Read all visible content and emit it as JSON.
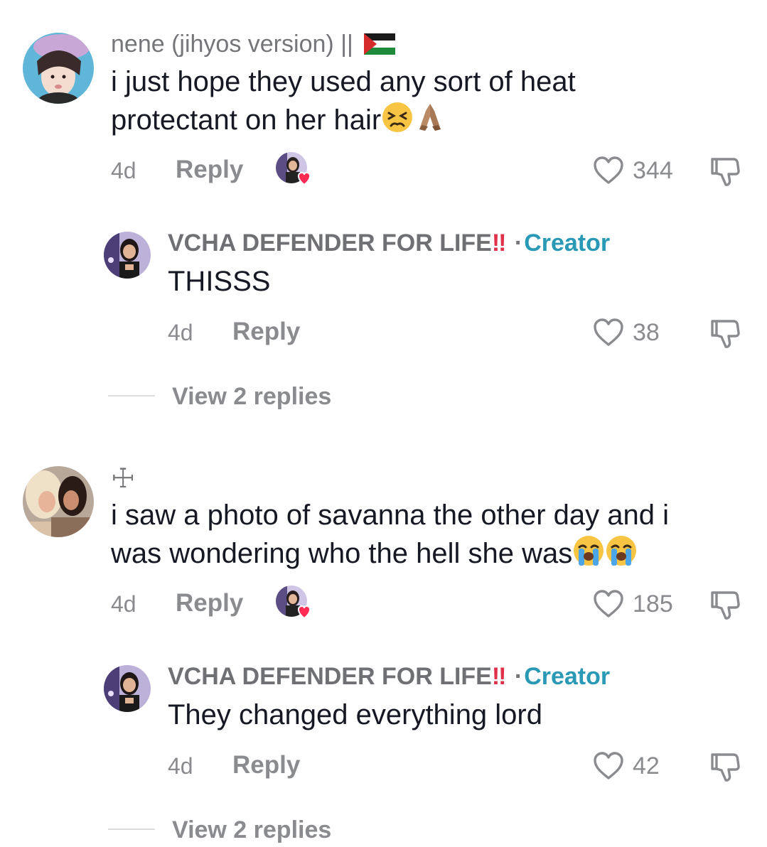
{
  "comments": [
    {
      "username": "nene (jihyos version) ||",
      "text_line1": "i just hope they used any sort of heat",
      "text_line2": "protectant on her hair",
      "time": "4d",
      "reply_label": "Reply",
      "likes": "344",
      "reply": {
        "username": "VCHA DEFENDER FOR LIFE",
        "bangs": "‼",
        "separator": "·",
        "creator_label": "Creator",
        "text": "THISSS",
        "time": "4d",
        "reply_label": "Reply",
        "likes": "38"
      },
      "view_replies": "View 2 replies"
    },
    {
      "username": "☩",
      "text_line1": "i saw a photo of savanna the other day and i",
      "text_line2": "was wondering who the hell she was",
      "time": "4d",
      "reply_label": "Reply",
      "likes": "185",
      "reply": {
        "username": "VCHA DEFENDER FOR LIFE",
        "bangs": "‼",
        "separator": "·",
        "creator_label": "Creator",
        "text": "They changed everything lord",
        "time": "4d",
        "reply_label": "Reply",
        "likes": "42"
      },
      "view_replies": "View 2 replies"
    }
  ],
  "colors": {
    "creator_accent": "#2a99b6",
    "meta_gray": "#8a8b8f",
    "text": "#161823",
    "bang_red": "#e0304a"
  },
  "icons": {
    "like": "heart-outline-icon",
    "dislike": "thumbs-down-icon",
    "creator_liked": "creator-liked-badge",
    "flag": "palestine-flag-icon"
  }
}
